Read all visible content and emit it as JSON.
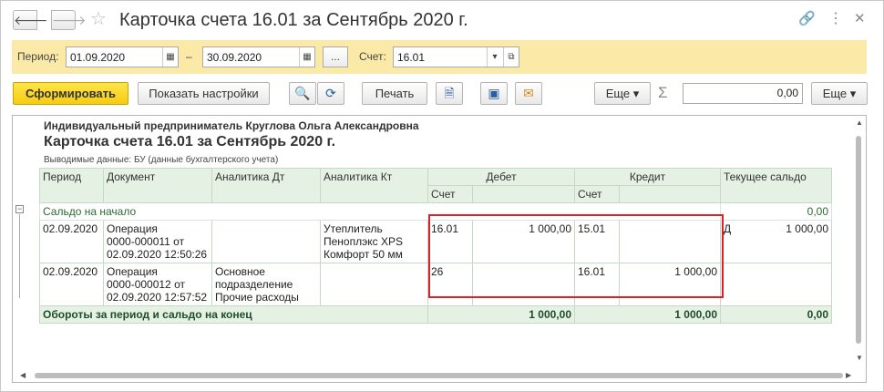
{
  "window": {
    "title": "Карточка счета 16.01 за Сентябрь 2020 г.",
    "back_glyph": "🡐",
    "forward_glyph": "🡒",
    "star_glyph": "☆",
    "link_glyph": "🔗",
    "more_glyph": "⋮",
    "close_glyph": "✕"
  },
  "params": {
    "period_label": "Период:",
    "date_from": "01.09.2020",
    "dash": "–",
    "date_to": "30.09.2020",
    "ellipsis": "...",
    "account_label": "Счет:",
    "account": "16.01"
  },
  "toolbar": {
    "generate": "Сформировать",
    "settings": "Показать настройки",
    "print": "Печать",
    "more1": "Еще ▾",
    "sum_value": "0,00",
    "more2": "Еще ▾",
    "sigma": "Σ"
  },
  "report": {
    "org": "Индивидуальный предприниматель Круглова Ольга Александровна",
    "title": "Карточка счета 16.01 за Сентябрь 2020 г.",
    "subtitle": "Выводимые данные:  БУ (данные бухгалтерского учета)",
    "headers": {
      "period": "Период",
      "document": "Документ",
      "analytics_dt": "Аналитика Дт",
      "analytics_kt": "Аналитика Кт",
      "debit": "Дебет",
      "credit": "Кредит",
      "balance": "Текущее сальдо",
      "debit_account": "Счет",
      "credit_account": "Счет"
    },
    "opening": {
      "label": "Сальдо на начало",
      "value": "0,00"
    },
    "rows": [
      {
        "period": "02.09.2020",
        "document": [
          "Операция",
          "0000-000011 от",
          "02.09.2020 12:50:26"
        ],
        "analytics_dt": [
          "",
          "",
          ""
        ],
        "analytics_kt": [
          "Утеплитель",
          "Пеноплэкс XPS",
          "Комфорт 50 мм"
        ],
        "debit_account": "16.01",
        "debit_amount": "1 000,00",
        "credit_account": "15.01",
        "credit_amount": "",
        "balance_side": "Д",
        "balance_value": "1 000,00"
      },
      {
        "period": "02.09.2020",
        "document": [
          "Операция",
          "0000-000012 от",
          "02.09.2020 12:57:52"
        ],
        "analytics_dt": [
          "Основное",
          "подразделение",
          "Прочие расходы"
        ],
        "analytics_kt": [
          "",
          "",
          ""
        ],
        "debit_account": "26",
        "debit_amount": "",
        "credit_account": "16.01",
        "credit_amount": "1 000,00",
        "balance_side": "",
        "balance_value": ""
      }
    ],
    "totals": {
      "label": "Обороты за период и сальдо на конец",
      "debit": "1 000,00",
      "credit": "1 000,00",
      "balance": "0,00"
    }
  }
}
